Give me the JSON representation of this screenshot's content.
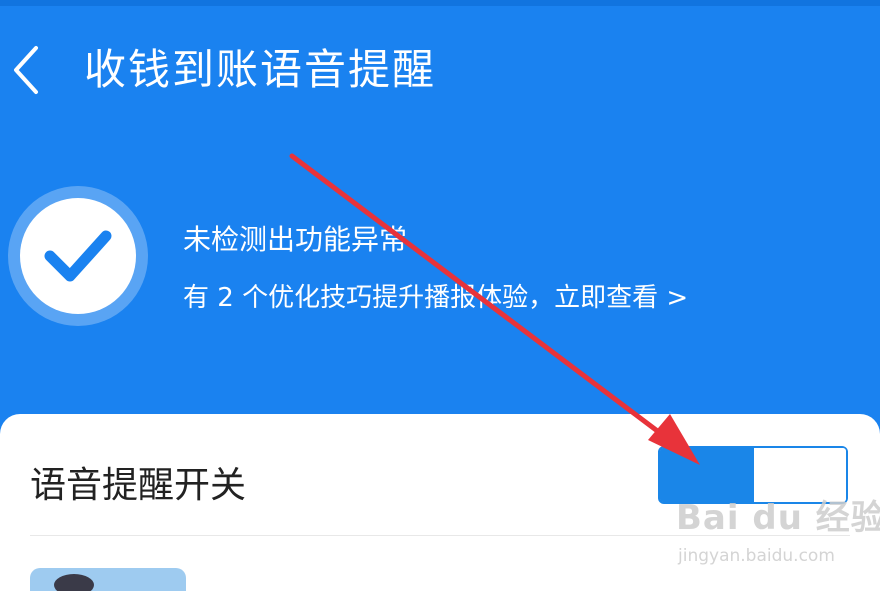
{
  "header": {
    "back_icon": "chevron-left-icon",
    "title": "收钱到账语音提醒"
  },
  "status": {
    "icon": "check-circle-icon",
    "title": "未检测出功能异常",
    "subtitle": "有 2 个优化技巧提升播报体验，立即查看 >"
  },
  "settings": {
    "voice_reminder_label": "语音提醒开关",
    "voice_reminder_on": true
  },
  "annotation": {
    "arrow_color": "#e8333a"
  },
  "watermark": {
    "logo_text": "Bai du 经验",
    "url": "jingyan.baidu.com"
  },
  "colors": {
    "header_bg": "#1a82f0",
    "toggle_on": "#1a86e8"
  }
}
